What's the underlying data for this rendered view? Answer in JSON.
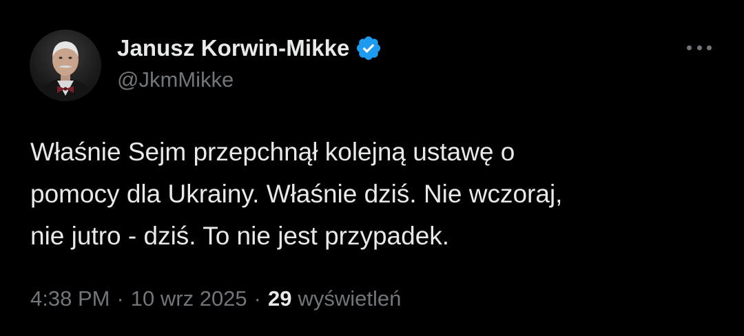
{
  "author": {
    "display_name": "Janusz Korwin-Mikke",
    "handle": "@JkmMikke",
    "verified": true,
    "verified_color": "#1d9bf0"
  },
  "tweet": {
    "lines": [
      "Właśnie Sejm przepchnął kolejną ustawę o",
      "pomocy dla Ukrainy. Właśnie dziś. Nie wczoraj,",
      "nie jutro - dziś. To nie jest przypadek."
    ]
  },
  "meta": {
    "time": "4:38 PM",
    "separator": "·",
    "date": "10 wrz 2025",
    "views_count": "29",
    "views_label": "wyświetleń"
  },
  "icons": {
    "more": "more-horizontal-icon",
    "verified": "verified-badge-icon"
  },
  "colors": {
    "background": "#000000",
    "text_primary": "#e7e9ea",
    "text_secondary": "#71767b"
  }
}
